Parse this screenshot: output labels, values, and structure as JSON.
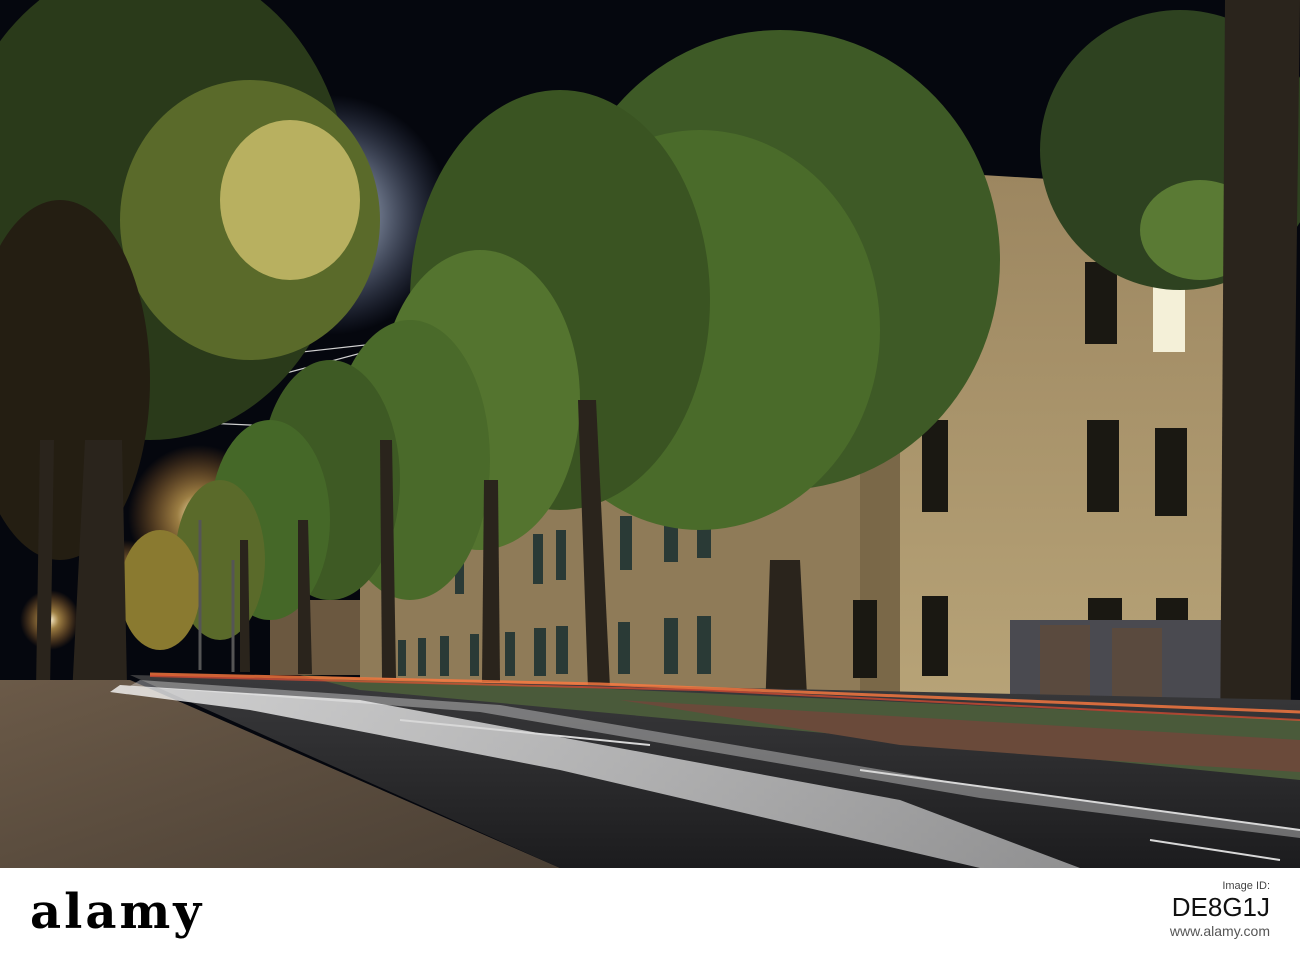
{
  "photo": {
    "subject": "Night street lined with trees, brick building and streetlights with light trails"
  },
  "footer": {
    "brand_text": "alamy",
    "image_id_label": "Image ID:",
    "image_id": "DE8G1J",
    "url": "www.alamy.com"
  },
  "colors": {
    "sky": "#05070e",
    "foliage": "#4a6b2a",
    "brick": "#a89466",
    "streetlight": "#ffb347",
    "light_trail": "#ffffff"
  }
}
